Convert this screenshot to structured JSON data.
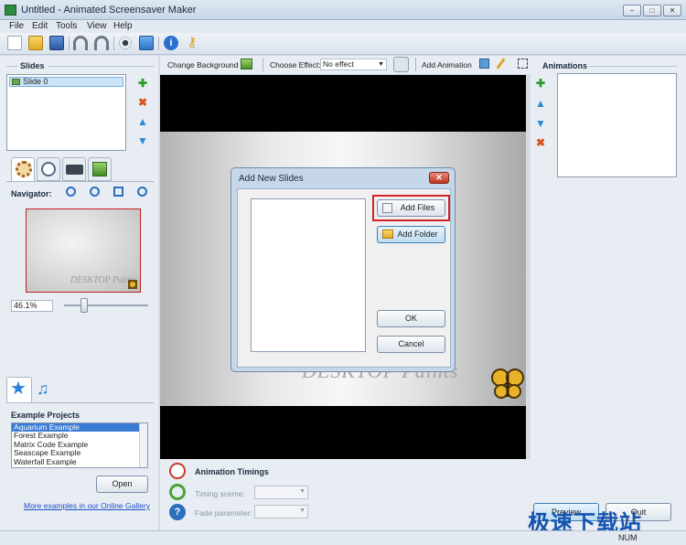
{
  "window": {
    "title": "Untitled - Animated Screensaver Maker",
    "minimize_glyph": "−",
    "maximize_glyph": "□",
    "close_glyph": "✕"
  },
  "menu": [
    "File",
    "Edit",
    "Tools",
    "View",
    "Help"
  ],
  "toolbar_icons": [
    "new-icon",
    "open-folder-icon",
    "save-icon",
    "undo-icon",
    "redo-icon",
    "preview-eye-icon",
    "publish-icon",
    "info-icon",
    "key-icon"
  ],
  "slides": {
    "heading": "Slides",
    "items": [
      "Slide 0"
    ]
  },
  "navigator": {
    "label": "Navigator:",
    "zoom": "46.1%",
    "zoom_level": 0.2
  },
  "example_projects": {
    "heading": "Example Projects",
    "items": [
      "Aquarium Example",
      "Forest Example",
      "Matrix Code Example",
      "Seascape Example",
      "Waterfall Example"
    ],
    "selected_index": 0,
    "open_label": "Open",
    "gallery_link": "More examples in our Online Gallery"
  },
  "slide_toolbar": {
    "change_background": "Change Background",
    "choose_effect": "Choose Effect:",
    "effect_value": "No effect",
    "add_animation": "Add Animation"
  },
  "canvas": {
    "watermark_text": "DESKTOP Paints"
  },
  "dialog": {
    "title": "Add New Slides",
    "close_glyph": "✕",
    "add_files": "Add Files",
    "add_folder": "Add Folder",
    "ok": "OK",
    "cancel": "Cancel"
  },
  "timings": {
    "heading": "Animation Timings",
    "timing_scene_label": "Timing sceme:",
    "fade_parameter_label": "Fade parameter:"
  },
  "animations": {
    "heading": "Animations"
  },
  "bottom_buttons": {
    "preview": "Preview",
    "quit": "Quit"
  },
  "status": {
    "num": "NUM"
  },
  "overlay_watermark": "极速下载站",
  "colors": {
    "accent_blue": "#1553b0",
    "highlight_red": "#d2232a",
    "add_green": "#2e9a2e",
    "remove_red": "#d9541e",
    "move_blue": "#2b8ad6"
  }
}
